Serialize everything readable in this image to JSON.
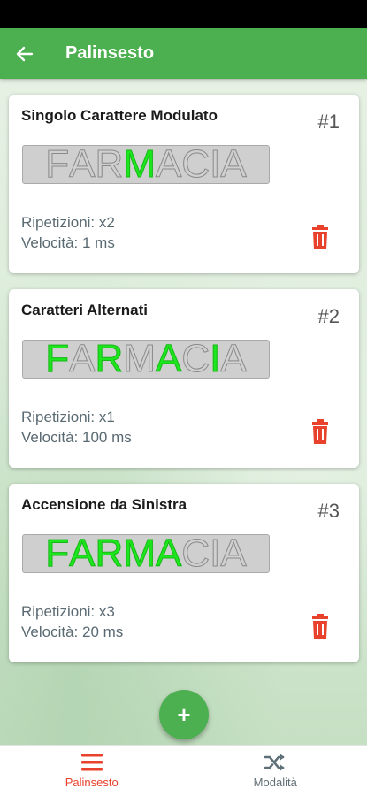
{
  "app_bar": {
    "title": "Palinsesto",
    "back_icon": "arrow-left-icon"
  },
  "cards": [
    {
      "title": "Singolo Carattere Modulato",
      "number": "#1",
      "sign": [
        {
          "char": "F",
          "lit": false
        },
        {
          "char": "A",
          "lit": false
        },
        {
          "char": "R",
          "lit": false
        },
        {
          "char": "M",
          "lit": true
        },
        {
          "char": "A",
          "lit": false
        },
        {
          "char": "C",
          "lit": false
        },
        {
          "char": "I",
          "lit": false
        },
        {
          "char": "A",
          "lit": false
        }
      ],
      "repetitions": "Ripetizioni: x2",
      "speed": "Velocità: 1 ms"
    },
    {
      "title": "Caratteri Alternati",
      "number": "#2",
      "sign": [
        {
          "char": "F",
          "lit": true
        },
        {
          "char": "A",
          "lit": false
        },
        {
          "char": "R",
          "lit": true
        },
        {
          "char": "M",
          "lit": false
        },
        {
          "char": "A",
          "lit": true
        },
        {
          "char": "C",
          "lit": false
        },
        {
          "char": "I",
          "lit": true
        },
        {
          "char": "A",
          "lit": false
        }
      ],
      "repetitions": "Ripetizioni: x1",
      "speed": "Velocità: 100 ms"
    },
    {
      "title": "Accensione da Sinistra",
      "number": "#3",
      "sign": [
        {
          "char": "F",
          "lit": true
        },
        {
          "char": "A",
          "lit": true
        },
        {
          "char": "R",
          "lit": true
        },
        {
          "char": "M",
          "lit": true
        },
        {
          "char": "A",
          "lit": true
        },
        {
          "char": "C",
          "lit": false
        },
        {
          "char": "I",
          "lit": false
        },
        {
          "char": "A",
          "lit": false
        }
      ],
      "repetitions": "Ripetizioni: x3",
      "speed": "Velocità: 20 ms"
    }
  ],
  "fab": {
    "icon": "plus-icon",
    "label": "+"
  },
  "bottom_nav": [
    {
      "label": "Palinsesto",
      "icon": "menu-lines-icon",
      "active": true
    },
    {
      "label": "Modalità",
      "icon": "shuffle-icon",
      "active": false
    }
  ],
  "colors": {
    "primary": "#4caf50",
    "accent_red": "#e8412c",
    "sign_lit": "#1ee61e",
    "sign_off": "#d0d0d0"
  }
}
